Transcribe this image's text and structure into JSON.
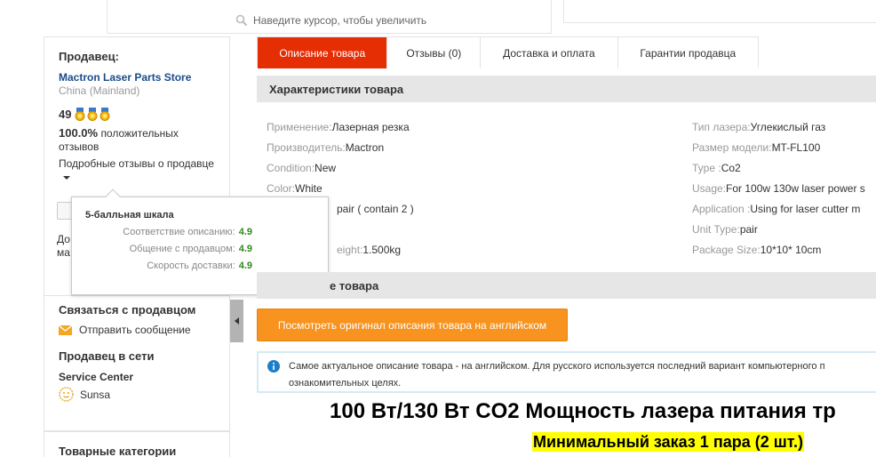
{
  "zoom": {
    "hint": "Наведите курсор, чтобы увеличить"
  },
  "seller": {
    "title": "Продавец:",
    "store_name": "Mactron Laser Parts Store",
    "country": "China (Mainland)",
    "rating": "49",
    "positive_pct": "100.0%",
    "positive_label": "положительных отзывов",
    "detail_link": "Подробные отзывы о продавце",
    "hidden_text1": "До",
    "hidden_text2": "ма"
  },
  "popup": {
    "title": "5-балльная шкала",
    "rows": [
      {
        "label": "Соответствие описанию:",
        "score": "4.9"
      },
      {
        "label": "Общение с продавцом:",
        "score": "4.9"
      },
      {
        "label": "Скорость доставки:",
        "score": "4.9"
      }
    ]
  },
  "contact": {
    "title": "Связаться с продавцом",
    "send_message": "Отправить сообщение",
    "online_title": "Продавец в сети",
    "service_center": "Service Center",
    "agent": "Sunsa"
  },
  "categories": {
    "title": "Товарные категории"
  },
  "tabs": [
    {
      "label": "Описание товара"
    },
    {
      "label": "Отзывы (0)"
    },
    {
      "label": "Доставка и оплата"
    },
    {
      "label": "Гарантии продавца"
    }
  ],
  "specs_title": "Характеристики товара",
  "specs_left": [
    {
      "k": "Применение:",
      "v": "Лазерная резка"
    },
    {
      "k": "Производитель:",
      "v": "Mactron"
    },
    {
      "k": "Condition:",
      "v": "New"
    },
    {
      "k": "Color:",
      "v": "White"
    },
    {
      "k": "",
      "v": "pair ( contain 2 )"
    },
    {
      "k": "",
      "v": ""
    },
    {
      "k": "eight:",
      "v": "1.500kg"
    }
  ],
  "specs_right": [
    {
      "k": "Тип лазера:",
      "v": "Углекислый газ"
    },
    {
      "k": "Размер модели:",
      "v": "MT-FL100"
    },
    {
      "k": "Type :",
      "v": "Co2"
    },
    {
      "k": "Usage:",
      "v": "For 100w 130w laser power s"
    },
    {
      "k": "Application :",
      "v": "Using for laser cutter m"
    },
    {
      "k": "Unit Type:",
      "v": "pair"
    },
    {
      "k": "Package Size:",
      "v": "10*10* 10cm"
    }
  ],
  "desc_title": "е товара",
  "orig_button": "Посмотреть оригинал описания товара на английском",
  "info_text": "Самое актуальное описание товара - на английском. Для русского используется последний вариант компьютерного п ознакомительных целях.",
  "big_title": "100 Вт/130 Вт CO2 Мощность лазера питания тр",
  "min_order": "Минимальный заказ 1 пара (2 шт.)",
  "colors": {
    "accent": "#e62e04",
    "orange_button": "#f7931e",
    "link": "#1a4b8c",
    "score": "#2e8b1b"
  }
}
